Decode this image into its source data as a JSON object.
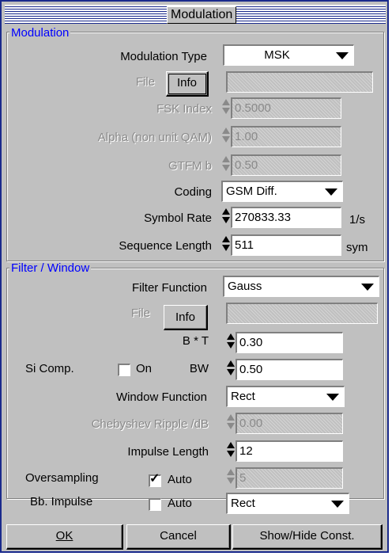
{
  "window": {
    "title": "Modulation"
  },
  "modulation": {
    "legend": "Modulation",
    "type_label": "Modulation Type",
    "type_value": "MSK",
    "file_label": "File",
    "info_button": "Info",
    "file_value": "",
    "fsk_label": "FSK Index",
    "fsk_value": "0.5000",
    "alpha_label": "Alpha (non unit QAM)",
    "alpha_value": "1.00",
    "gtfm_label": "GTFM b",
    "gtfm_value": "0.50",
    "coding_label": "Coding",
    "coding_value": "GSM Diff.",
    "symbol_rate_label": "Symbol  Rate",
    "symbol_rate_value": "270833.33",
    "symbol_rate_unit": "1/s",
    "seq_len_label": "Sequence Length",
    "seq_len_value": "511",
    "seq_len_unit": "sym"
  },
  "filter": {
    "legend": "Filter / Window",
    "function_label": "Filter Function",
    "function_value": "Gauss",
    "file_label": "File",
    "info_button": "Info",
    "file_value": "",
    "bt_label": "B * T",
    "bt_value": "0.30",
    "si_label": "Si Comp.",
    "on_label": "On",
    "on_checked": false,
    "bw_label": "BW",
    "bw_value": "0.50",
    "window_label": "Window Function",
    "window_value": "Rect",
    "cheb_label": "Chebyshev Ripple /dB",
    "cheb_value": "0.00",
    "impulse_label": "Impulse Length",
    "impulse_value": "12",
    "oversampling_label": "Oversampling",
    "oversampling_auto_label": "Auto",
    "oversampling_auto_checked": true,
    "oversampling_value": "5",
    "bb_label": "Bb. Impulse",
    "bb_auto_label": "Auto",
    "bb_auto_checked": false,
    "bb_value": "Rect"
  },
  "buttons": {
    "ok": "OK",
    "cancel": "Cancel",
    "show_hide": "Show/Hide Const."
  }
}
